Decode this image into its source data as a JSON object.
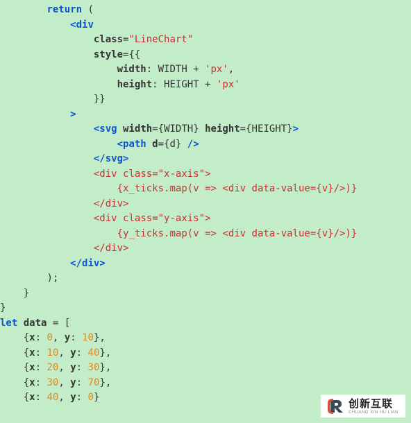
{
  "code": {
    "t": {
      "return": "return",
      "let": "let",
      "open": "<",
      "close": ">",
      "sclose": "/>",
      "eopen": "</",
      "lparen": "(",
      "rparen": ")",
      "semi": ";",
      "comma": ",",
      "eq": "=",
      "lbr": "{",
      "rbr": "}",
      "lbr2": "{{",
      "rbr2": "}}",
      "lbrk": "[",
      "rbrk": "]",
      "plus": "+",
      "colon": ":",
      "arrow": "=>"
    },
    "tags": {
      "div": "div",
      "svg": "svg",
      "path": "path"
    },
    "attrs": {
      "class": "class",
      "style": "style",
      "width": "width",
      "height": "height",
      "d": "d",
      "dataValue": "data-value"
    },
    "vals": {
      "lineChart": "\"LineChart\"",
      "px": "'px'",
      "WIDTH": "WIDTH",
      "HEIGHT": "HEIGHT",
      "d": "d",
      "xaxis": "\"x-axis\"",
      "yaxis": "\"y-axis\"",
      "v": "v"
    },
    "ids": {
      "widthKey": "width",
      "heightKey": "height",
      "x_ticks": "x_ticks",
      "y_ticks": "y_ticks",
      "map": "map",
      "data": "data",
      "x": "x",
      "y": "y"
    },
    "arr": [
      {
        "x": "0",
        "y": "10"
      },
      {
        "x": "10",
        "y": "40"
      },
      {
        "x": "20",
        "y": "30"
      },
      {
        "x": "30",
        "y": "70"
      },
      {
        "x": "40",
        "y": "0"
      }
    ]
  },
  "watermark": {
    "cn": "创新互联",
    "py": "CHUANG XIN HU LIAN"
  }
}
